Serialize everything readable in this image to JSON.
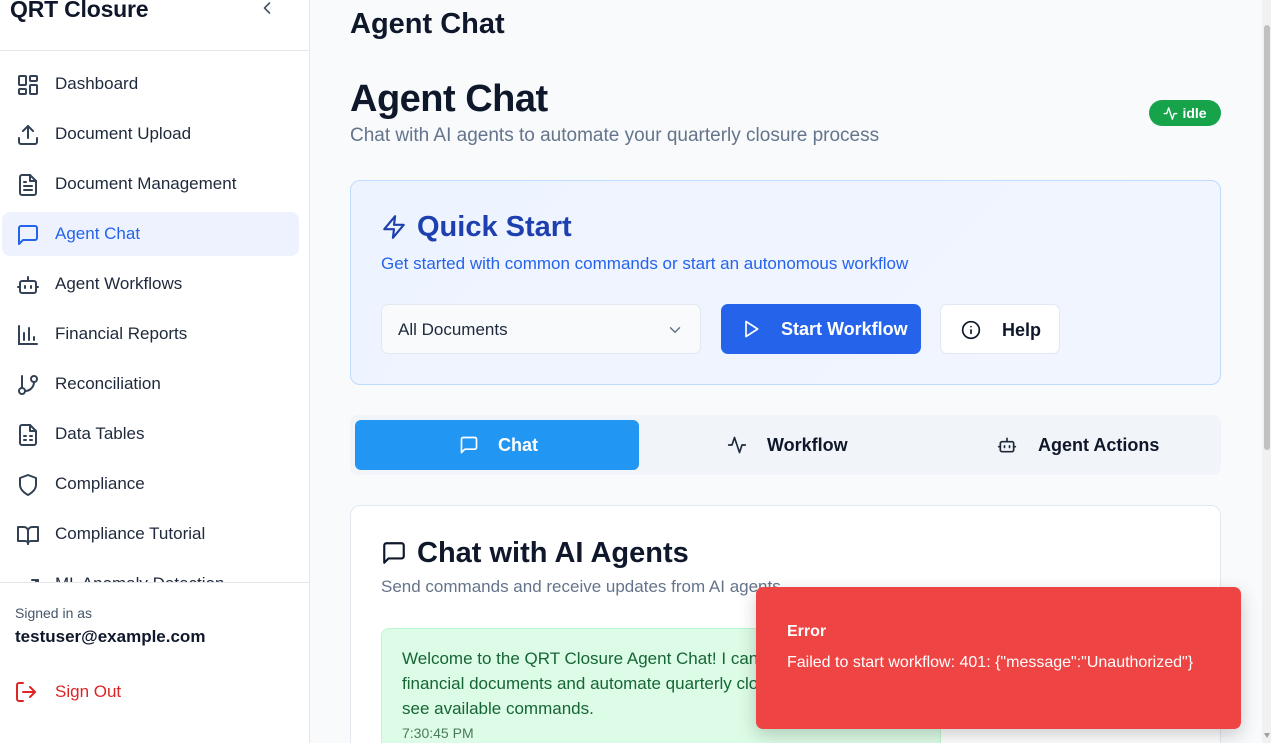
{
  "app": {
    "title": "QRT Closure"
  },
  "sidebar": {
    "items": [
      {
        "label": "Dashboard",
        "icon": "dashboard-icon"
      },
      {
        "label": "Document Upload",
        "icon": "upload-icon"
      },
      {
        "label": "Document Management",
        "icon": "file-text-icon"
      },
      {
        "label": "Agent Chat",
        "icon": "message-square-icon",
        "active": true
      },
      {
        "label": "Agent Workflows",
        "icon": "bot-icon"
      },
      {
        "label": "Financial Reports",
        "icon": "bar-chart-icon"
      },
      {
        "label": "Reconciliation",
        "icon": "git-branch-icon"
      },
      {
        "label": "Data Tables",
        "icon": "file-spreadsheet-icon"
      },
      {
        "label": "Compliance",
        "icon": "shield-icon"
      },
      {
        "label": "Compliance Tutorial",
        "icon": "book-open-icon"
      },
      {
        "label": "ML Anomaly Detection",
        "icon": "trending-up-icon"
      }
    ],
    "signed_in_label": "Signed in as",
    "user_email": "testuser@example.com",
    "sign_out_label": "Sign Out"
  },
  "header": {
    "title": "Agent Chat"
  },
  "page": {
    "title": "Agent Chat",
    "subtitle": "Chat with AI agents to automate your quarterly closure process",
    "status": "idle"
  },
  "quick_start": {
    "title": "Quick Start",
    "description": "Get started with common commands or start an autonomous workflow",
    "select_value": "All Documents",
    "start_label": "Start Workflow",
    "help_label": "Help"
  },
  "tabs": [
    {
      "label": "Chat",
      "icon": "message-square-icon",
      "active": true
    },
    {
      "label": "Workflow",
      "icon": "activity-icon"
    },
    {
      "label": "Agent Actions",
      "icon": "bot-icon"
    }
  ],
  "chat": {
    "title": "Chat with AI Agents",
    "description": "Send commands and receive updates from AI agents",
    "messages": [
      {
        "text": "Welcome to the QRT Closure Agent Chat! I can help you process financial documents and automate quarterly closure. Type \"help\" to see available commands.",
        "time": "7:30:45 PM"
      }
    ]
  },
  "toast": {
    "title": "Error",
    "message": "Failed to start workflow: 401: {\"message\":\"Unauthorized\"}"
  },
  "colors": {
    "accent": "#2563eb",
    "tab_active": "#2196f3",
    "success": "#16a34a",
    "error": "#ef4444"
  }
}
